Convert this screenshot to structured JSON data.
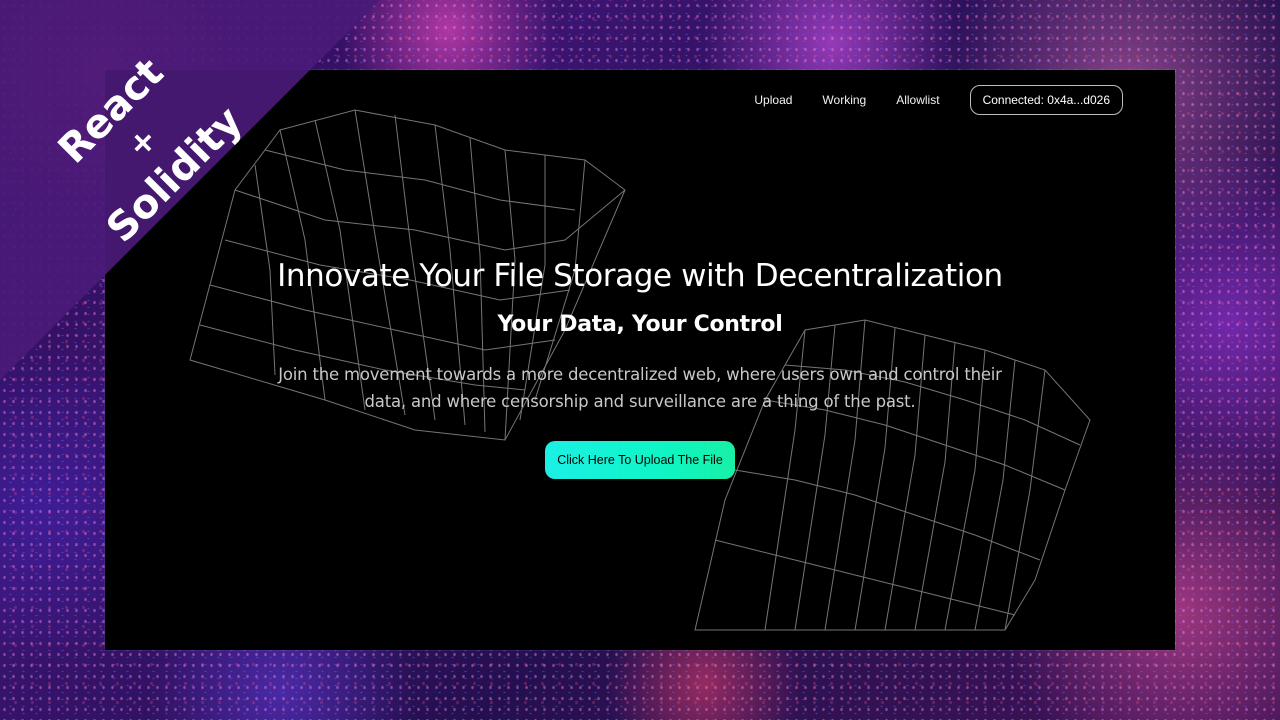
{
  "nav": {
    "links": [
      "Upload",
      "Working",
      "Allowlist"
    ],
    "connect_label": "Connected: 0x4a...d026"
  },
  "hero": {
    "title": "Innovate Your File Storage with Decentralization",
    "subtitle": "Your Data, Your Control",
    "description": "Join the movement towards a more decentralized web, where users own and control their data, and where censorship and surveillance are a thing of the past.",
    "cta_label": "Click Here To Upload The File"
  },
  "ribbon": {
    "line1": "React",
    "line2": "+",
    "line3": "Solidity"
  },
  "colors": {
    "accent_start": "#1cf0e6",
    "accent_end": "#18f0a6",
    "ribbon": "#4a1a78",
    "background": "#000000"
  }
}
